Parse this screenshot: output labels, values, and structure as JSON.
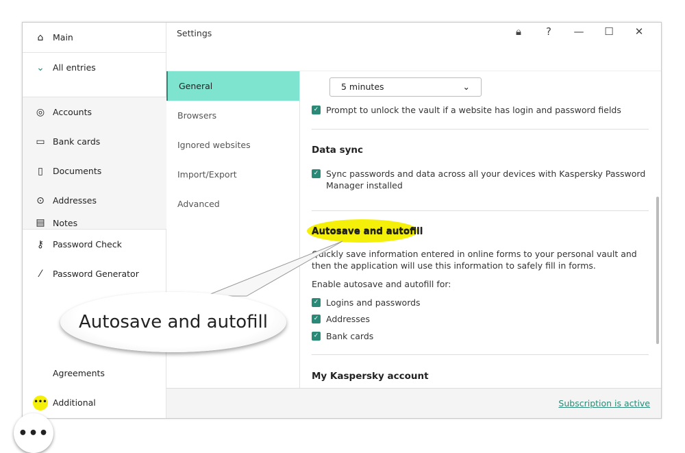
{
  "sidebar": {
    "main": "Main",
    "all_entries": "All entries",
    "accounts": "Accounts",
    "bank_cards": "Bank cards",
    "documents": "Documents",
    "addresses": "Addresses",
    "notes": "Notes",
    "password_check": "Password Check",
    "password_generator": "Password Generator",
    "agreements": "Agreements",
    "additional": "Additional"
  },
  "header": {
    "title": "Settings"
  },
  "nav": [
    "General",
    "Browsers",
    "Ignored websites",
    "Import/Export",
    "Advanced"
  ],
  "content": {
    "timeout_value": "5 minutes",
    "prompt_unlock": "Prompt to unlock the vault if a website has login and password fields",
    "data_sync_heading": "Data sync",
    "sync_label": "Sync passwords and data across all your devices with Kaspersky Password Manager installed",
    "autosave_heading": "Autosave and autofill",
    "autosave_desc": "Quickly save information entered in online forms to your personal vault and then the application will use this information to safely fill in forms.",
    "enable_label": "Enable autosave and autofill for:",
    "options": [
      "Logins and passwords",
      "Addresses",
      "Bank cards"
    ],
    "account_heading": "My Kaspersky account"
  },
  "footer": {
    "subscription": "Subscription is active"
  },
  "callout": {
    "text": "Autosave and autofill"
  },
  "colors": {
    "accent": "#7ee3cf",
    "check": "#2a8a77",
    "highlight": "#f4f00a"
  }
}
